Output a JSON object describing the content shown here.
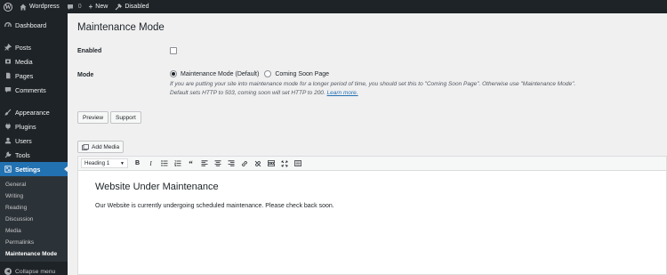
{
  "adminbar": {
    "site_name": "Wordpress",
    "comments_count": "0",
    "new_label": "New",
    "mode_status": "Disabled"
  },
  "sidebar": {
    "items": [
      {
        "label": "Dashboard",
        "icon": "gauge-icon"
      },
      {
        "label": "Posts",
        "icon": "pin-icon"
      },
      {
        "label": "Media",
        "icon": "media-icon"
      },
      {
        "label": "Pages",
        "icon": "page-icon"
      },
      {
        "label": "Comments",
        "icon": "comment-icon"
      },
      {
        "label": "Appearance",
        "icon": "brush-icon"
      },
      {
        "label": "Plugins",
        "icon": "plug-icon"
      },
      {
        "label": "Users",
        "icon": "user-icon"
      },
      {
        "label": "Tools",
        "icon": "wrench-icon"
      },
      {
        "label": "Settings",
        "icon": "settings-icon"
      }
    ],
    "submenu": [
      "General",
      "Writing",
      "Reading",
      "Discussion",
      "Media",
      "Permalinks",
      "Maintenance Mode"
    ],
    "collapse_label": "Collapse menu"
  },
  "page": {
    "title": "Maintenance Mode",
    "enabled_label": "Enabled",
    "mode_label": "Mode",
    "mode_options": [
      "Maintenance Mode (Default)",
      "Coming Soon Page"
    ],
    "mode_selected": "Maintenance Mode (Default)",
    "description_line1": "If you are putting your site into maintenance mode for a longer period of time, you should set this to \"Coming Soon Page\". Otherwise use \"Maintenance Mode\".",
    "description_line2": "Default sets HTTP to 503, coming soon will set HTTP to 200.",
    "learn_more": "Learn more.",
    "preview_label": "Preview",
    "support_label": "Support",
    "add_media_label": "Add Media"
  },
  "editor": {
    "format_value": "Heading 1",
    "heading": "Website Under Maintenance",
    "body": "Our Website is currently undergoing scheduled maintenance. Please check back soon."
  },
  "colors": {
    "admin_bg": "#1d2327",
    "accent": "#2271b1",
    "page_bg": "#f0f0f1"
  }
}
